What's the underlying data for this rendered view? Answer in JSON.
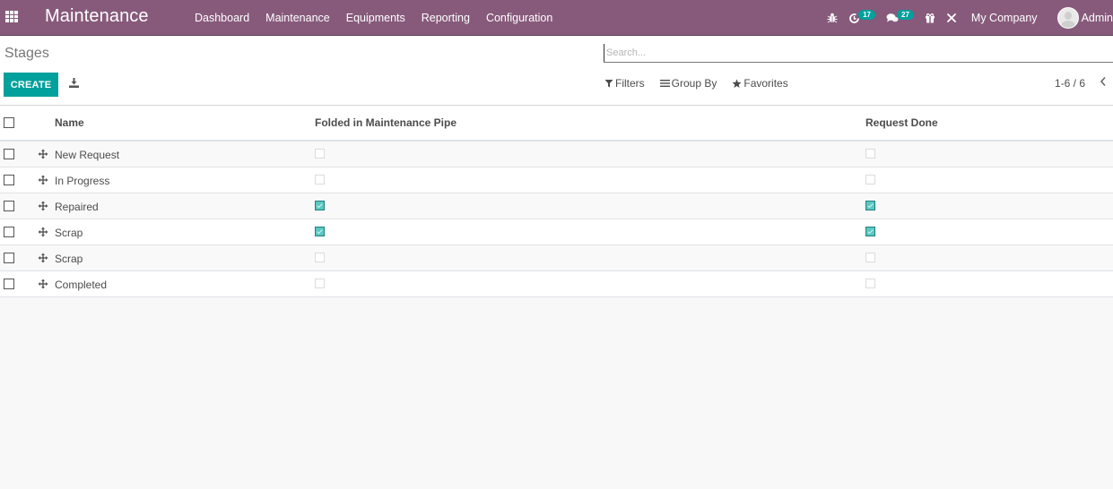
{
  "navbar": {
    "app_title": "Maintenance",
    "menu": [
      {
        "label": "Dashboard"
      },
      {
        "label": "Maintenance"
      },
      {
        "label": "Equipments"
      },
      {
        "label": "Reporting"
      },
      {
        "label": "Configuration"
      }
    ],
    "systray": {
      "debug_icon": "bug-icon",
      "activity_icon": "clock-icon",
      "activity_count": "17",
      "messages_icon": "comments-icon",
      "messages_count": "27",
      "gift_icon": "gift-icon",
      "tools_icon": "close-tools-icon",
      "company": "My Company",
      "user": "Admin"
    }
  },
  "control_panel": {
    "breadcrumb": "Stages",
    "create_label": "CREATE",
    "download_icon": "download-icon",
    "search": {
      "value": "",
      "placeholder": "Search..."
    },
    "filters_label": "Filters",
    "group_by_label": "Group By",
    "favorites_label": "Favorites",
    "pager": "1-6 / 6",
    "pager_prev": "‹"
  },
  "table": {
    "columns": [
      {
        "key": "name",
        "label": "Name"
      },
      {
        "key": "fold",
        "label": "Folded in Maintenance Pipe"
      },
      {
        "key": "done",
        "label": "Request Done"
      }
    ],
    "rows": [
      {
        "name": "New Request",
        "fold": false,
        "done": false
      },
      {
        "name": "In Progress",
        "fold": false,
        "done": false
      },
      {
        "name": "Repaired",
        "fold": true,
        "done": true
      },
      {
        "name": "Scrap",
        "fold": true,
        "done": true
      },
      {
        "name": "Scrap",
        "fold": false,
        "done": false
      },
      {
        "name": "Completed",
        "fold": false,
        "done": false
      }
    ]
  },
  "colors": {
    "navbar": "#875a7b",
    "primary": "#00a09d",
    "checked": "#5bc8c2"
  }
}
